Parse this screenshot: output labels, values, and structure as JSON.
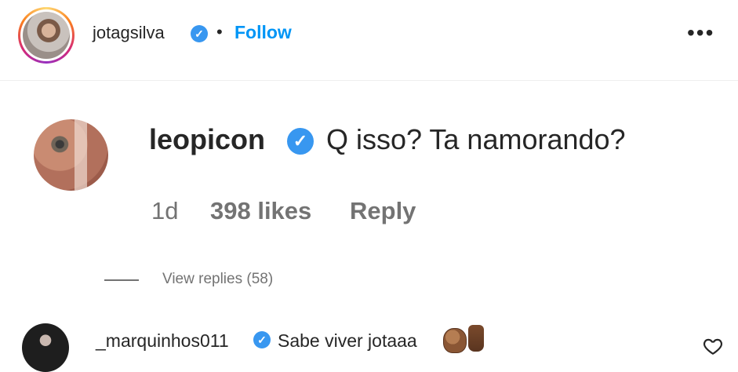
{
  "header": {
    "username": "jotagsilva",
    "separator": "•",
    "follow_label": "Follow",
    "more_label": "•••"
  },
  "main_comment": {
    "username": "leopicon",
    "text": "Q isso? Ta namorando?",
    "time": "1d",
    "likes": "398 likes",
    "reply_label": "Reply",
    "view_replies": "View replies (58)"
  },
  "second_comment": {
    "username": "_marquinhos011",
    "text": "Sabe viver jotaaa"
  },
  "icons": {
    "verified": "verified-badge-icon",
    "more": "more-options-icon",
    "heart": "heart-icon"
  },
  "colors": {
    "accent": "#0095f6",
    "verified": "#3897f0",
    "muted": "#737373",
    "text": "#262626"
  }
}
